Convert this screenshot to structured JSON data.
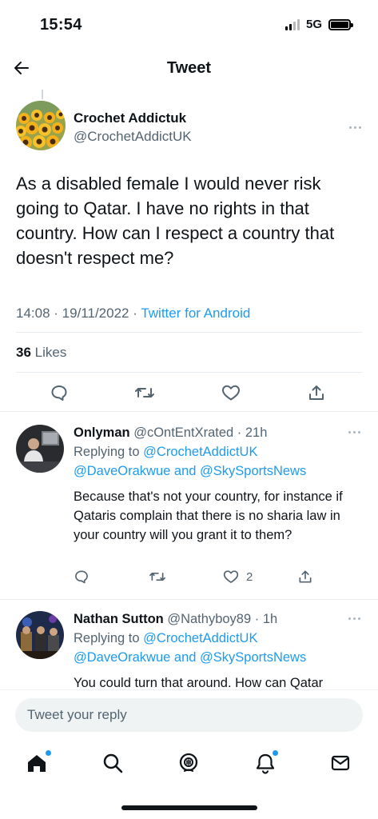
{
  "status_bar": {
    "time": "15:54",
    "network": "5G"
  },
  "header": {
    "title": "Tweet"
  },
  "tweet": {
    "author_name": "Crochet Addictuk",
    "author_handle": "@CrochetAddictUK",
    "text": "As a disabled female I would never risk going to Qatar. I have no rights in that country. How can I respect a country that doesn't respect me?",
    "time": "14:08",
    "date": "19/11/2022",
    "source": "Twitter for Android",
    "likes_count": "36",
    "likes_label": "Likes"
  },
  "replies": [
    {
      "name": "Onlyman",
      "handle": "@cOntEntXrated",
      "age": "21h",
      "replying_prefix": "Replying to",
      "replying_handle_1": "@CrochetAddictUK",
      "replying_handle_2": "@DaveOrakwue",
      "replying_joiner": "and",
      "replying_handle_3": "@SkySportsNews",
      "text": "Because that's not your country, for instance if Qataris complain that there is no sharia law in your country will you grant it to them?",
      "like_count": "2"
    },
    {
      "name": "Nathan Sutton",
      "handle": "@Nathyboy89",
      "age": "1h",
      "replying_prefix": "Replying to",
      "replying_handle_1": "@CrochetAddictUK",
      "replying_handle_2": "@DaveOrakwue",
      "replying_joiner": "and",
      "replying_handle_3": "@SkySportsNews",
      "text": "You could turn that around. How can Qatar"
    }
  ],
  "reply_box": {
    "placeholder": "Tweet your reply"
  },
  "icons": {
    "back": "arrow-left-icon",
    "more": "more-horizontal-icon",
    "reply": "comment-icon",
    "retweet": "retweet-icon",
    "like": "heart-icon",
    "share": "share-icon",
    "nav": [
      "home-icon",
      "search-icon",
      "spaces-icon",
      "notifications-icon",
      "messages-icon"
    ]
  },
  "colors": {
    "accent": "#1d9bf0",
    "text": "#0f1419",
    "muted": "#536471"
  }
}
